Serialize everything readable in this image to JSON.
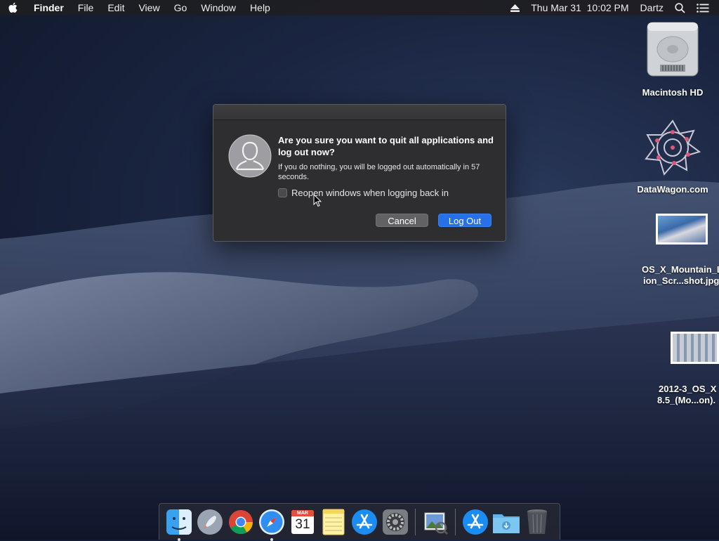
{
  "menubar": {
    "app_name": "Finder",
    "menus": [
      "File",
      "Edit",
      "View",
      "Go",
      "Window",
      "Help"
    ],
    "datetime": "Thu Mar 31  10:02 PM",
    "user": "Dartz"
  },
  "desktop": {
    "icons": [
      {
        "label": "Macintosh HD"
      },
      {
        "label": "DataWagon.com"
      },
      {
        "label_line1": "OS_X_Mountain_L",
        "label_line2": "ion_Scr...shot.jpg"
      },
      {
        "label_line1": "2012-3_OS_X",
        "label_line2": "8.5_(Mo...on)."
      }
    ]
  },
  "dialog": {
    "title": "Are you sure you want to quit all applications and log out now?",
    "message": "If you do nothing, you will be logged out automatically in 57 seconds.",
    "checkbox_label": "Reopen windows when logging back in",
    "checkbox_checked": false,
    "cancel_label": "Cancel",
    "logout_label": "Log Out"
  },
  "dock": {
    "calendar_month": "MAR",
    "calendar_day": "31",
    "items": [
      "finder",
      "launchpad",
      "chrome",
      "safari",
      "calendar",
      "notes",
      "app-store",
      "system-preferences",
      "preview",
      "app-store-downloads",
      "downloads-folder",
      "trash"
    ]
  },
  "colors": {
    "accent": "#2670e8",
    "dialog_bg": "#2e2e30"
  }
}
